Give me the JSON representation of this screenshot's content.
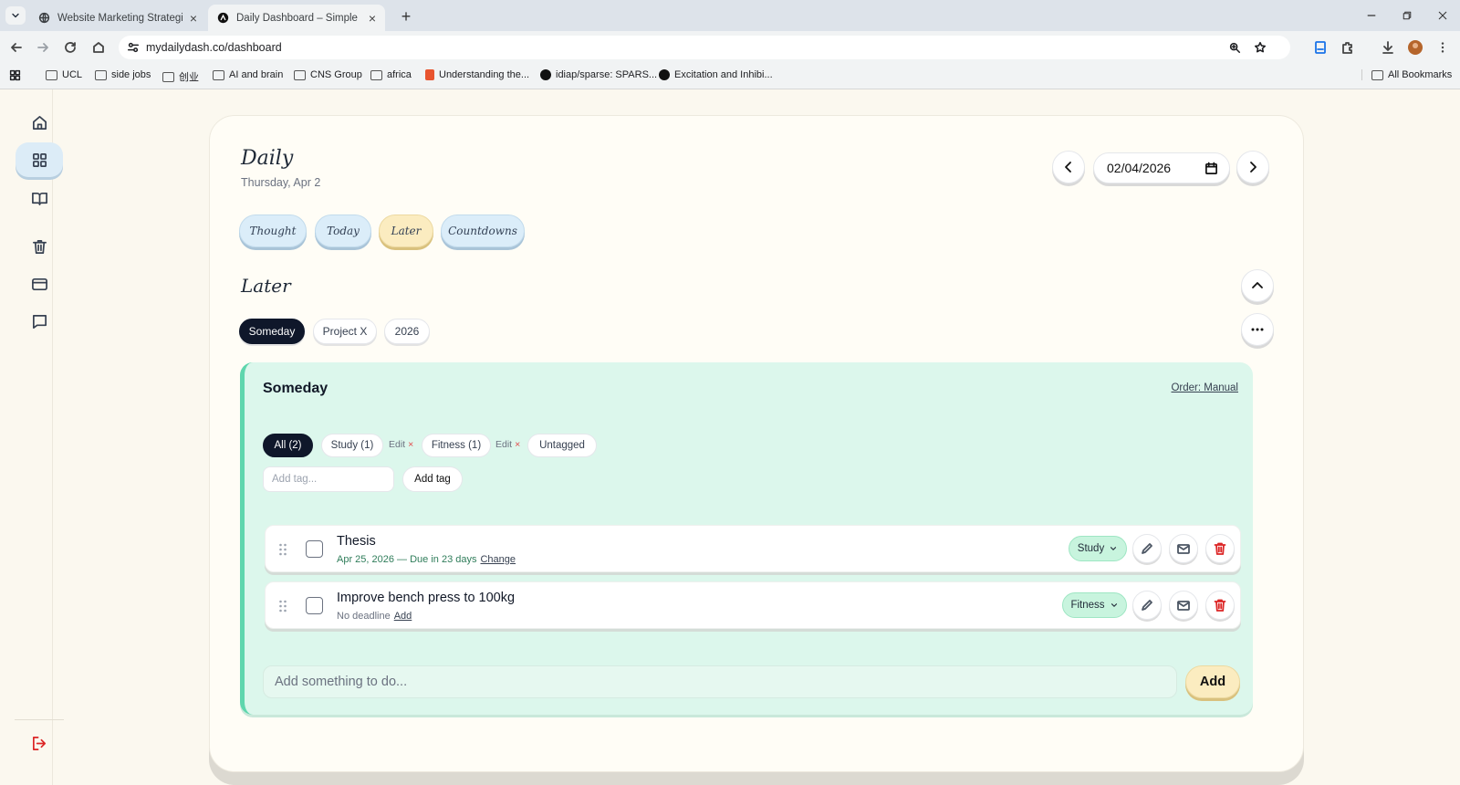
{
  "browser": {
    "tabs": [
      {
        "title": "Website Marketing Strategies",
        "active": false
      },
      {
        "title": "Daily Dashboard – Simple Life &",
        "active": true
      }
    ],
    "url": "mydailydash.co/dashboard",
    "bookmarks": [
      "UCL",
      "side jobs",
      "创业",
      "AI and brain",
      "CNS Group",
      "africa",
      "Understanding the...",
      "idiap/sparse: SPARS...",
      "Excitation and Inhibi..."
    ],
    "all_bookmarks": "All Bookmarks"
  },
  "header": {
    "title": "Daily",
    "date_text": "Thursday, Apr 2",
    "date_value": "02/04/2026"
  },
  "pills": [
    "Thought",
    "Today",
    "Later",
    "Countdowns"
  ],
  "section": {
    "title": "Later",
    "lists": [
      "Someday",
      "Project X",
      "2026"
    ]
  },
  "panel": {
    "title": "Someday",
    "order": "Order: Manual",
    "filters": {
      "all": "All (2)",
      "study": "Study (1)",
      "fitness": "Fitness (1)",
      "untagged": "Untagged",
      "edit": "Edit",
      "remove": "×"
    },
    "tag_placeholder": "Add tag...",
    "add_tag": "Add tag",
    "tasks": [
      {
        "title": "Thesis",
        "sub": "Apr 25, 2026 — Due in 23 days",
        "link": "Change",
        "category": "Study"
      },
      {
        "title": "Improve bench press to 100kg",
        "sub": "No deadline",
        "link": "Add",
        "category": "Fitness"
      }
    ],
    "todo_placeholder": "Add something to do...",
    "add": "Add"
  },
  "colors": {
    "accent_green": "#5fd6ad",
    "panel_bg": "#dcf7ec",
    "pill_blue": "#dbedf9",
    "pill_yellow": "#fbecc0",
    "dark": "#0f172a",
    "delete_red": "#dc2626"
  },
  "icons": {
    "rail": [
      "home-icon",
      "dashboard-icon",
      "book-icon",
      "trash-icon",
      "card-icon",
      "chat-icon",
      "logout-icon"
    ]
  }
}
